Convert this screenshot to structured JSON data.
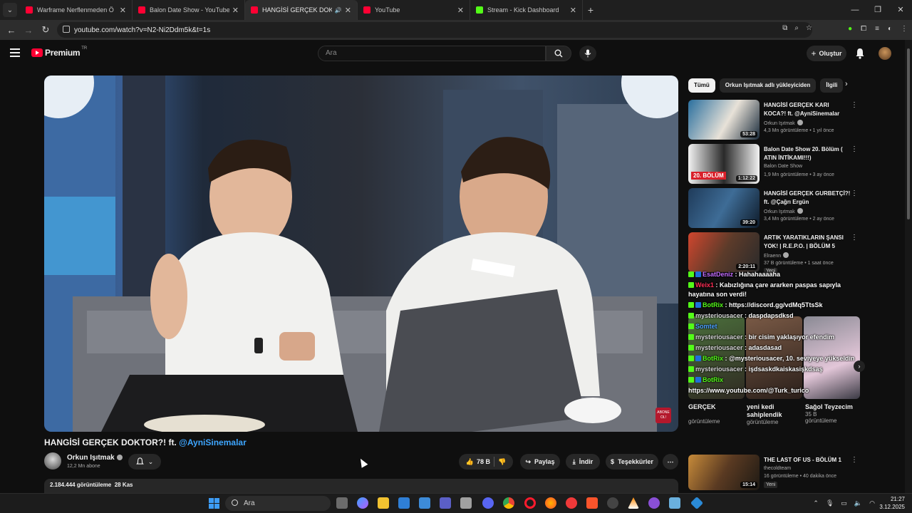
{
  "browser": {
    "tabs": [
      {
        "title": "Warframe Nerflenmeden Ö",
        "icon": "youtube-icon",
        "active": false
      },
      {
        "title": "Balon Date Show - YouTube",
        "icon": "youtube-icon",
        "active": false
      },
      {
        "title": "HANGİSİ GERÇEK DOKTOR",
        "icon": "youtube-icon",
        "active": true
      },
      {
        "title": "YouTube",
        "icon": "youtube-icon",
        "active": false
      },
      {
        "title": "Stream - Kick Dashboard",
        "icon": "kick-icon",
        "active": false
      }
    ],
    "new_tab": "+",
    "url": "youtube.com/watch?v=N2-Ni2Ddm5k&t=1s"
  },
  "youtube": {
    "logo_text": "Premium",
    "logo_region": "TR",
    "search_placeholder": "Ara",
    "create_label": "Oluştur"
  },
  "video": {
    "title_text": "HANGİSİ GERÇEK DOKTOR?! ft. ",
    "title_mention": "@AyniSinemalar",
    "channel_name": "Orkun Işıtmak",
    "subscribers": "12,2 Mn abone",
    "likes": "78 B",
    "share_label": "Paylaş",
    "download_label": "İndir",
    "thanks_label": "Teşekkürler",
    "views_line": "2.184.444 görüntüleme  28 Kas",
    "corner_badge": "ABONE OL!"
  },
  "sidebar": {
    "chips": [
      "Tümü",
      "Orkun Işıtmak adlı yükleyiciden",
      "İlgili"
    ],
    "recommendations": [
      {
        "title": "HANGİSİ GERÇEK KARI KOCA?! ft. @AyniSinemalar",
        "channel": "Orkun Işıtmak",
        "meta": "4,3 Mn görüntüleme • 1 yıl önce",
        "duration": "53:28",
        "verified": true
      },
      {
        "title": "Balon Date Show 20. Bölüm ( ATIN İNTİKAMI!!!)",
        "channel": "Balon Date Show",
        "meta": "1,9 Mn görüntüleme • 3 ay önce",
        "duration": "1:12:22",
        "verified": false
      },
      {
        "title": "HANGİSİ GERÇEK GURBETÇİ?! ft. @Çağrı Ergün",
        "channel": "Orkun Işıtmak",
        "meta": "3,4 Mn görüntüleme • 2 ay önce",
        "duration": "39:20",
        "verified": true
      },
      {
        "title": "ARTIK YARATIKLARIN ŞANSI YOK! | R.E.P.O. | BÖLÜM 5",
        "channel": "Elraenn",
        "meta": "37 B görüntüleme • 1 saat önce",
        "duration": "2:20:11",
        "verified": true,
        "badge": "Yeni"
      }
    ],
    "shorts": [
      {
        "title": "GERÇEK",
        "meta": "görüntüleme"
      },
      {
        "title": "yeni kedi sahiplendik",
        "meta": "görüntüleme"
      },
      {
        "title": "Sağol Teyzecim",
        "meta": "görüntüleme",
        "views": "35 B"
      }
    ],
    "last_rec": {
      "title": "THE LAST OF US - BÖLÜM 1",
      "channel": "thecoldteam",
      "meta": "16 görüntüleme • 40 dakika önce",
      "duration": "15:14",
      "badge": "Yeni"
    }
  },
  "chat": [
    {
      "user": "EsatDeniz",
      "text": " : Hahahaaaaha",
      "color": "purple",
      "mod": true
    },
    {
      "user": "Weix1",
      "text": " : Kabızlığına çare ararken paspas sapıyla hayatına son verdi!",
      "color": "red",
      "mod": false
    },
    {
      "user": "BotRix",
      "text": " : https://discord.gg/vdMq5TtsSk",
      "color": "green",
      "mod": true
    },
    {
      "user": "mysteriousacer",
      "text": " : daspdapsdksd",
      "color": "gray",
      "mod": false
    },
    {
      "user": "Somtet",
      "text": "",
      "color": "blue",
      "mod": false
    },
    {
      "user": "mysteriousacer",
      "text": " : bir cisim yaklaşıyor efendim",
      "color": "gray",
      "mod": false
    },
    {
      "user": "mysteriousacer",
      "text": " : adasdasad",
      "color": "gray",
      "mod": false
    },
    {
      "user": "BotRix",
      "text": " : @mysteriousacer, 10. seviyeye yükseldin",
      "color": "green",
      "mod": true
    },
    {
      "user": "mysteriousacer",
      "text": " : işdsaskdkaiskasişkdsaş",
      "color": "gray",
      "mod": false
    },
    {
      "user": "BotRix",
      "text": "",
      "color": "green",
      "mod": true
    },
    {
      "user": "",
      "text": "https://www.youtube.com/@Turk_turico",
      "color": "gray",
      "mod": false
    }
  ],
  "taskbar": {
    "search_placeholder": "Ara",
    "time": "21:27",
    "date": "3.12.2025"
  }
}
